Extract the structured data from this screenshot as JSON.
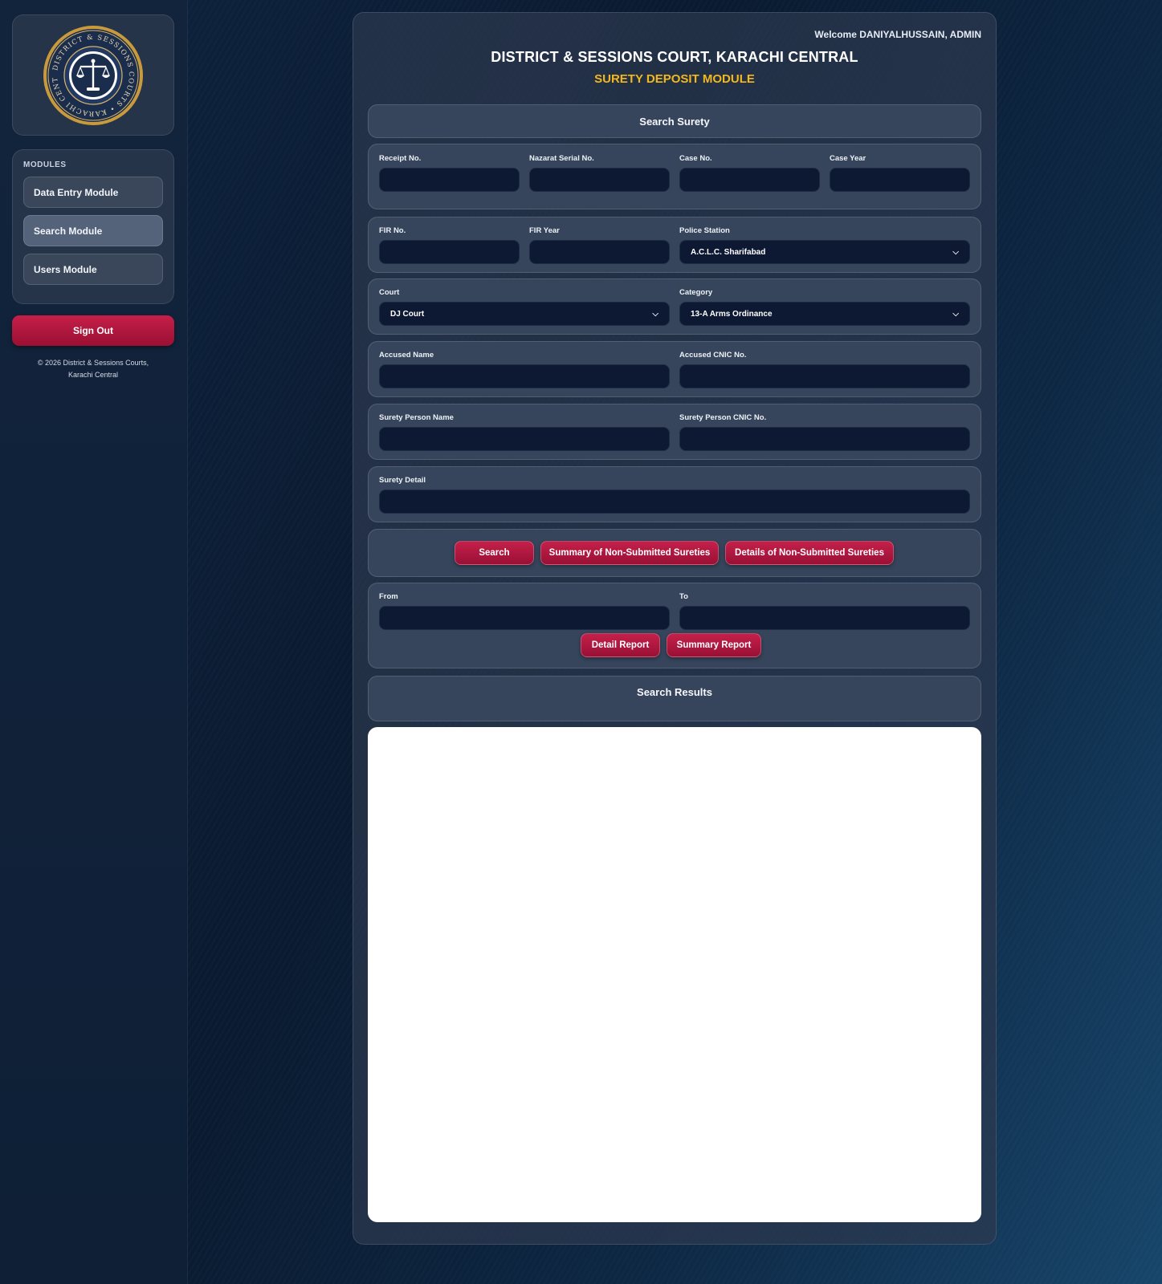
{
  "sidebar": {
    "logo_text": "DISTRICT & SESSIONS COURTS · KARACHI CENTRAL",
    "modules_title": "MODULES",
    "items": [
      {
        "label": "Data Entry Module"
      },
      {
        "label": "Search Module"
      },
      {
        "label": "Users Module"
      }
    ],
    "signout_label": "Sign Out",
    "copyright_line1": "© 2026 District & Sessions Courts,",
    "copyright_line2": "Karachi Central"
  },
  "header": {
    "welcome": "Welcome DANIYALHUSSAIN, ADMIN",
    "title": "DISTRICT & SESSIONS COURT, KARACHI CENTRAL",
    "subtitle": "SURETY DEPOSIT MODULE"
  },
  "search_panel": {
    "title": "Search Surety"
  },
  "fields": {
    "receipt_no": {
      "label": "Receipt No.",
      "value": ""
    },
    "nazarat_serial_no": {
      "label": "Nazarat Serial No.",
      "value": ""
    },
    "case_no": {
      "label": "Case No.",
      "value": ""
    },
    "case_year": {
      "label": "Case Year",
      "value": ""
    },
    "fir_no": {
      "label": "FIR No.",
      "value": ""
    },
    "fir_year": {
      "label": "FIR Year",
      "value": ""
    },
    "police_station": {
      "label": "Police Station",
      "value": "A.C.L.C. Sharifabad"
    },
    "court": {
      "label": "Court",
      "value": "DJ Court"
    },
    "category": {
      "label": "Category",
      "value": "13-A Arms Ordinance"
    },
    "accused_name": {
      "label": "Accused Name",
      "value": ""
    },
    "accused_cnic": {
      "label": "Accused CNIC No.",
      "value": ""
    },
    "surety_person_name": {
      "label": "Surety Person Name",
      "value": ""
    },
    "surety_person_cnic": {
      "label": "Surety Person CNIC No.",
      "value": ""
    },
    "surety_detail": {
      "label": "Surety Detail",
      "value": ""
    },
    "from": {
      "label": "From",
      "value": ""
    },
    "to": {
      "label": "To",
      "value": ""
    }
  },
  "actions": {
    "search": "Search",
    "summary_non_submitted": "Summary of Non-Submitted Sureties",
    "details_non_submitted": "Details of Non-Submitted Sureties",
    "detail_report": "Detail Report",
    "summary_report": "Summary Report"
  },
  "results": {
    "title": "Search Results"
  },
  "colors": {
    "accent": "#f4b81c",
    "button": "#b5173f",
    "panel": "#36455c",
    "input": "#0d1933"
  }
}
